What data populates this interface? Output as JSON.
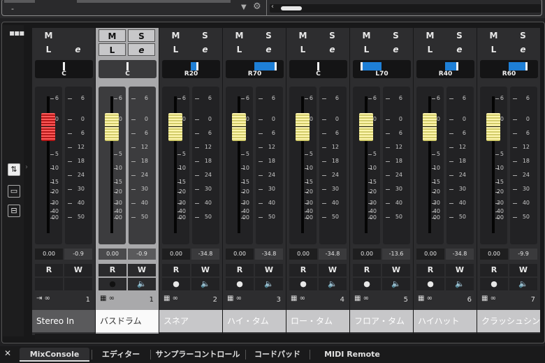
{
  "window": {
    "dash_label": "-"
  },
  "left_tools": {
    "tools": [
      "sliders-tool",
      "monitor-tool",
      "routing-tool"
    ]
  },
  "strip_buttons": {
    "mute": "M",
    "solo": "S",
    "listen": "L",
    "edit": "e",
    "read": "R",
    "write": "W"
  },
  "fader_scale": [
    "6",
    "0",
    "5",
    "10",
    "15",
    "20",
    "30",
    "40",
    "00"
  ],
  "meter_scale": [
    "6",
    "0",
    "6",
    "12",
    "18",
    "24",
    "30",
    "40",
    "50"
  ],
  "channels": [
    {
      "name": "Stereo In",
      "number": "1",
      "pan": "C",
      "pan_pos": 0.5,
      "pan_side": "center",
      "volume": "0.00",
      "peak": "-0.9",
      "fader": "red",
      "has_solo": false,
      "selected": false,
      "rec_enabled": false
    },
    {
      "name": "バスドラム",
      "number": "1",
      "pan": "C",
      "pan_pos": 0.5,
      "pan_side": "center",
      "volume": "0.00",
      "peak": "-0.9",
      "fader": "yellow",
      "has_solo": true,
      "selected": true,
      "rec_enabled": true
    },
    {
      "name": "スネア",
      "number": "2",
      "pan": "R20",
      "pan_pos": 0.6,
      "pan_side": "right",
      "volume": "0.00",
      "peak": "-34.8",
      "fader": "yellow",
      "has_solo": true,
      "selected": false,
      "rec_enabled": false
    },
    {
      "name": "ハイ・タム",
      "number": "3",
      "pan": "R70",
      "pan_pos": 0.85,
      "pan_side": "right",
      "volume": "0.00",
      "peak": "-34.8",
      "fader": "yellow",
      "has_solo": true,
      "selected": false,
      "rec_enabled": false
    },
    {
      "name": "ロー・タム",
      "number": "4",
      "pan": "C",
      "pan_pos": 0.5,
      "pan_side": "center",
      "volume": "0.00",
      "peak": "-34.8",
      "fader": "yellow",
      "has_solo": true,
      "selected": false,
      "rec_enabled": false
    },
    {
      "name": "フロア・タム",
      "number": "5",
      "pan": "L70",
      "pan_pos": 0.15,
      "pan_side": "left",
      "volume": "0.00",
      "peak": "-13.6",
      "fader": "yellow",
      "has_solo": true,
      "selected": false,
      "rec_enabled": false
    },
    {
      "name": "ハイハット",
      "number": "6",
      "pan": "R40",
      "pan_pos": 0.7,
      "pan_side": "right",
      "volume": "0.00",
      "peak": "-34.8",
      "fader": "yellow",
      "has_solo": true,
      "selected": false,
      "rec_enabled": false
    },
    {
      "name": "クラッシュシンバル",
      "number": "7",
      "pan": "R60",
      "pan_pos": 0.8,
      "pan_side": "right",
      "volume": "0.00",
      "peak": "-9.9",
      "fader": "yellow",
      "has_solo": true,
      "selected": false,
      "rec_enabled": false
    }
  ],
  "tabs": [
    {
      "label": "MixConsole",
      "active": true
    },
    {
      "label": "エディター",
      "active": false
    },
    {
      "label": "サンプラーコントロール",
      "active": false
    },
    {
      "label": "コードパッド",
      "active": false
    },
    {
      "label": "MIDI Remote",
      "active": false
    }
  ],
  "colors": {
    "accent_blue": "#1e7fd6",
    "record_red": "#e23a3a",
    "fader_yellow": "#e8e29a",
    "fader_red": "#d42424"
  }
}
